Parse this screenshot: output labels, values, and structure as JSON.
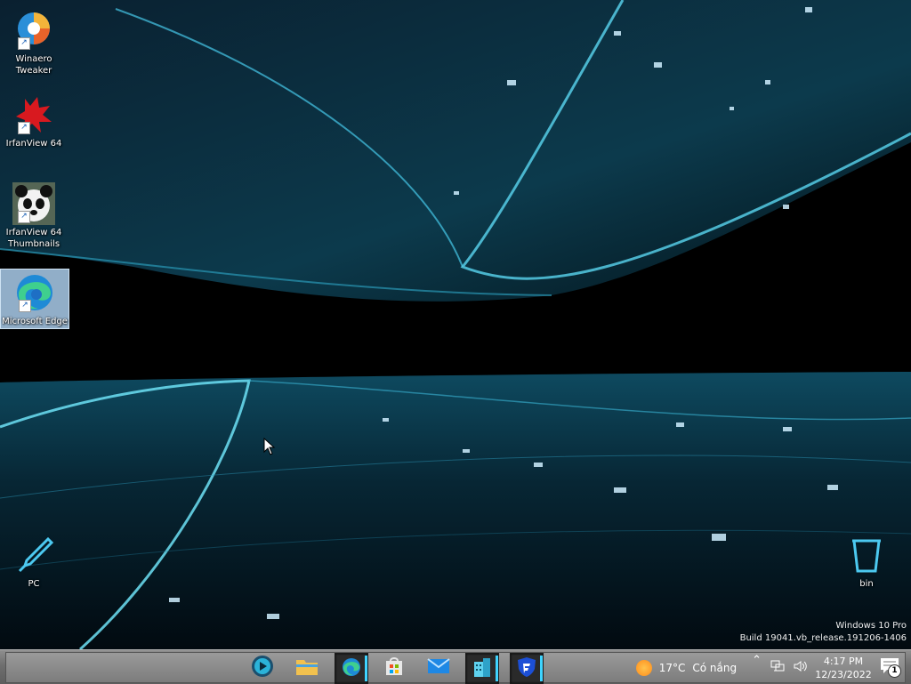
{
  "desktop": {
    "icons": [
      {
        "label": "Winaero\nTweaker",
        "name": "winaero-tweaker"
      },
      {
        "label": "IrfanView 64",
        "name": "irfanview-64"
      },
      {
        "label": "IrfanView 64\nThumbnails",
        "name": "irfanview-64-thumbnails"
      },
      {
        "label": "Microsoft Edge",
        "name": "microsoft-edge"
      },
      {
        "label": "PC",
        "name": "pc"
      },
      {
        "label": "bin",
        "name": "recycle-bin"
      }
    ],
    "watermark": {
      "line1": "Windows 10 Pro",
      "line2": "Build 19041.vb_release.191206-1406"
    }
  },
  "taskbar": {
    "apps": [
      {
        "icon": "media-player-icon"
      },
      {
        "icon": "file-explorer-icon"
      },
      {
        "icon": "edge-icon"
      },
      {
        "icon": "store-icon"
      },
      {
        "icon": "mail-icon"
      },
      {
        "icon": "app-building-icon"
      },
      {
        "icon": "shield-app-icon"
      }
    ],
    "weather": {
      "temp": "17°C",
      "desc": "Có nắng"
    },
    "clock": {
      "time": "4:17 PM",
      "date": "12/23/2022"
    },
    "notifications": "1",
    "colors": {
      "accent": "#3fd4ff",
      "taskbar": "#7a7a7a"
    }
  }
}
